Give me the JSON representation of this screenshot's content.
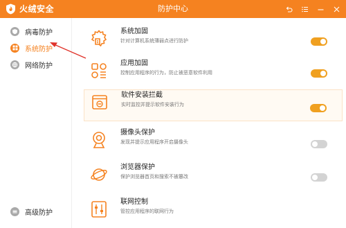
{
  "app": {
    "brand": "火绒安全",
    "window_title": "防护中心"
  },
  "colors": {
    "accent": "#f58220",
    "toggle_on": "#f0a020",
    "toggle_off": "#d3d3d3"
  },
  "window_controls": [
    {
      "icon": "back-icon"
    },
    {
      "icon": "menu-icon"
    },
    {
      "icon": "minimize-icon"
    },
    {
      "icon": "close-icon"
    }
  ],
  "sidebar": {
    "items": [
      {
        "label": "病毒防护",
        "icon": "virus-shield-icon",
        "active": false
      },
      {
        "label": "系统防护",
        "icon": "windows-icon",
        "active": true
      },
      {
        "label": "网络防护",
        "icon": "network-icon",
        "active": false
      }
    ],
    "bottom": {
      "label": "高级防护",
      "icon": "advanced-icon"
    }
  },
  "protections": [
    {
      "title": "系统加固",
      "desc": "针对计算机系统薄弱点进行防护",
      "icon": "gear-shield-icon",
      "enabled": true
    },
    {
      "title": "应用加固",
      "desc": "控制应用程序的行为，防止被恶意软件利用",
      "icon": "apps-icon",
      "enabled": true
    },
    {
      "title": "软件安装拦截",
      "desc": "实时监控并提示软件安装行为",
      "icon": "install-block-icon",
      "enabled": true
    },
    {
      "title": "摄像头保护",
      "desc": "发现并提示应用程序开启摄像头",
      "icon": "camera-icon",
      "enabled": false
    },
    {
      "title": "浏览器保护",
      "desc": "保护浏览器首页和搜索不被篡改",
      "icon": "browser-planet-icon",
      "enabled": false
    },
    {
      "title": "联网控制",
      "desc": "管控应用程序的联网行为",
      "icon": "network-control-icon",
      "enabled": null
    }
  ]
}
